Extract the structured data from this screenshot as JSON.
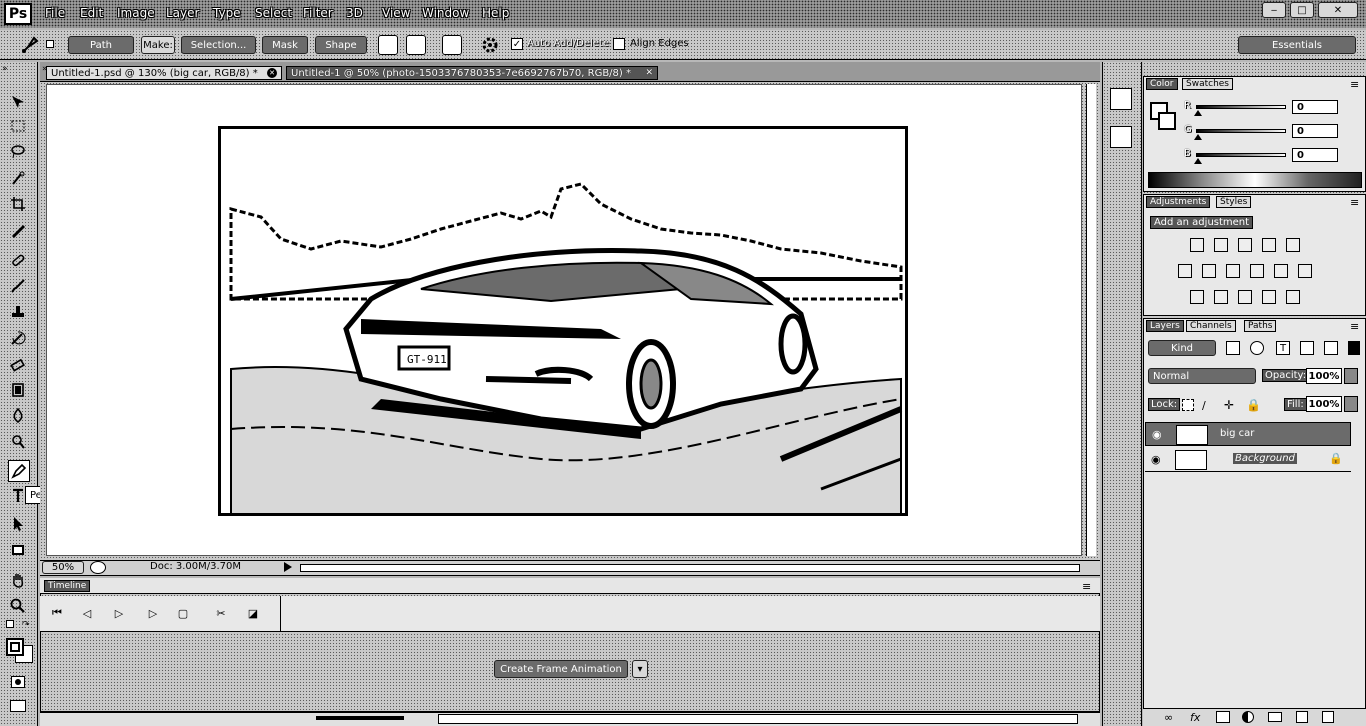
{
  "app": {
    "logo": "Ps"
  },
  "menu": [
    "File",
    "Edit",
    "Image",
    "Layer",
    "Type",
    "Select",
    "Filter",
    "3D",
    "View",
    "Window",
    "Help"
  ],
  "window_controls": [
    "minimize-icon",
    "restore-icon",
    "close-icon"
  ],
  "options_bar": {
    "mode_value": "Path",
    "make_label": "Make:",
    "selection_label": "Selection...",
    "mask_label": "Mask",
    "shape_label": "Shape",
    "auto_add_delete_label": "Auto Add/Delete",
    "auto_add_delete_checked": true,
    "align_edges_label": "Align Edges",
    "align_edges_checked": false,
    "workspace_label": "Essentials"
  },
  "doc_tabs": [
    {
      "label": "Untitled-1.psd @ 130% (big car, RGB/8) *",
      "active": true
    },
    {
      "label": "Untitled-1 @ 50% (photo-1503376780353-7e6692767b70, RGB/8) *",
      "active": false
    }
  ],
  "tooltip": {
    "text": "Pen Tool (P)"
  },
  "status_bar": {
    "zoom": "50%",
    "doc_info": "Doc: 3.00M/3.70M"
  },
  "timeline": {
    "tab_label": "Timeline",
    "create_button_label": "Create Frame Animation"
  },
  "color_panel": {
    "tabs": [
      "Color",
      "Swatches"
    ],
    "channels": [
      {
        "label": "R",
        "value": "0"
      },
      {
        "label": "G",
        "value": "0"
      },
      {
        "label": "B",
        "value": "0"
      }
    ]
  },
  "adjustments_panel": {
    "tabs": [
      "Adjustments",
      "Styles"
    ],
    "heading": "Add an adjustment"
  },
  "layers_panel": {
    "tabs": [
      "Layers",
      "Channels",
      "Paths"
    ],
    "filter_label": "Kind",
    "blend_mode": "Normal",
    "opacity_label": "Opacity:",
    "opacity_value": "100%",
    "lock_label": "Lock:",
    "fill_label": "Fill:",
    "fill_value": "100%",
    "layers": [
      {
        "name": "big car",
        "visible": true,
        "selected": true
      },
      {
        "name": "Background",
        "visible": true,
        "selected": false,
        "locked": true
      }
    ]
  },
  "colors": {
    "ui_dark": "#555555",
    "canvas_bg": "#ffffff",
    "selection": "#6b6b6b"
  }
}
